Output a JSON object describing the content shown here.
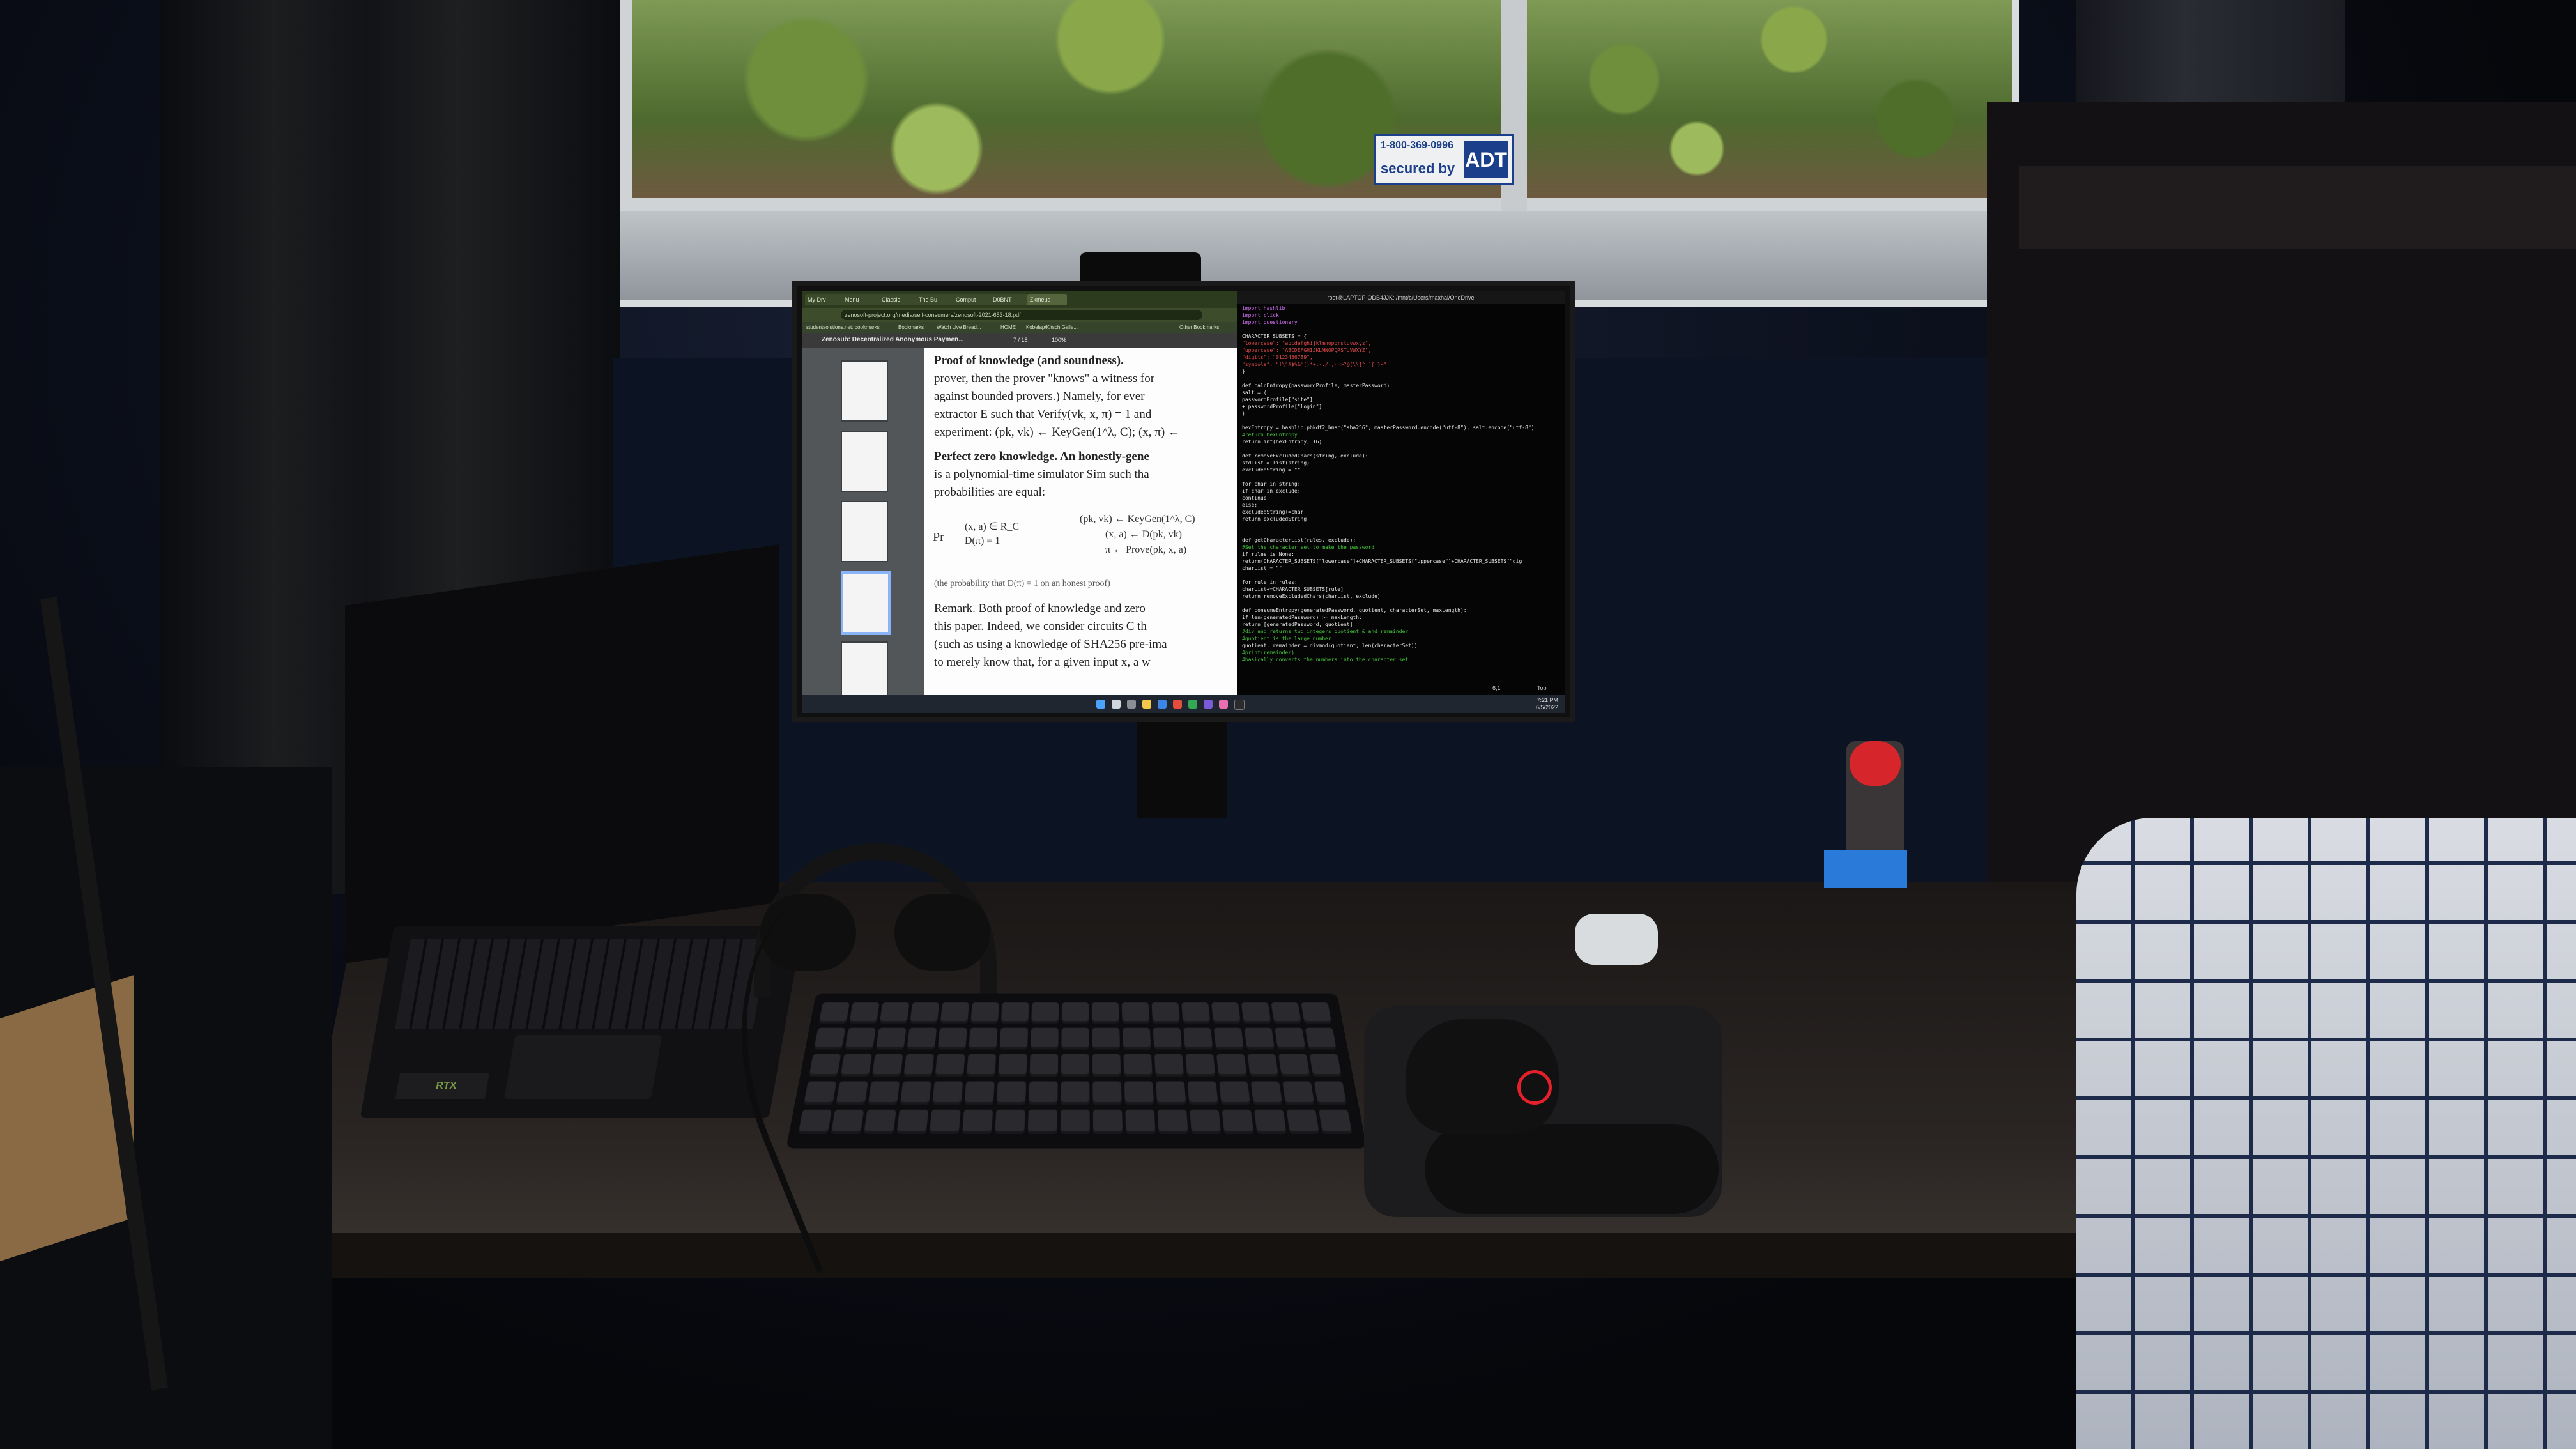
{
  "scene": {
    "window": {
      "sticker": {
        "phone": "1-800-369-0996",
        "label": "secured by",
        "brand": "ADT"
      }
    }
  },
  "monitor": {
    "browser": {
      "tabs": [
        "My Drv",
        "Menu",
        "Classic",
        "The Bu",
        "Comput",
        "D0BNT",
        "Zkmeus"
      ],
      "url": "zenosoft-project.org/media/self-consumers/zenosoft-2021-653-18.pdf",
      "bookmarks": [
        "studentsolutions.net: bookmarks",
        "Bookmarks",
        "Watch Live Bread...",
        "HOME",
        "Kobelap/Kitsch Galle...",
        "Other Bookmarks"
      ],
      "pdf": {
        "title": "Zenosub: Decentralized Anonymous Paymen...",
        "page_indicator": "7 / 18",
        "zoom": "100%",
        "lines": [
          "Proof of knowledge (and soundness).",
          "prover, then the prover \"knows\" a witness for",
          "against bounded provers.) Namely, for ever",
          "extractor E such that Verify(vk, x, π) = 1 and",
          "experiment: (pk, vk) ← KeyGen(1^λ, C); (x, π) ←",
          "Perfect zero knowledge.  An honestly-gene",
          "is a polynomial-time simulator Sim such tha",
          "probabilities are equal:",
          "(the probability that D(π) = 1 on an honest proof)",
          "Remark.  Both proof of knowledge and zero",
          "this paper. Indeed, we consider circuits C th",
          "(such as using a knowledge of SHA256 pre-ima",
          "to merely know that, for a given input x, a w"
        ],
        "formula": {
          "lhs_top": "(x, a) ∈ R_C",
          "lhs_bottom": "D(π) = 1",
          "rhs_1": "(pk, vk) ← KeyGen(1^λ, C)",
          "rhs_2": "(x, a) ← D(pk, vk)",
          "rhs_3": "π ← Prove(pk, x, a)",
          "prefix": "Pr"
        }
      }
    },
    "terminal": {
      "title": "root@LAPTOP-ODB4JJK: /mnt/c/Users/maxhal/OneDrive",
      "status_left": "6,1",
      "status_right": "Top",
      "code_lines": [
        {
          "text": "import hashlib",
          "color": "#d36ff3"
        },
        {
          "text": "import click",
          "color": "#d36ff3"
        },
        {
          "text": "import questionary",
          "color": "#d36ff3"
        },
        {
          "text": "",
          "color": "#cfcfcf"
        },
        {
          "text": "CHARACTER_SUBSETS = {",
          "color": "#e6e6e6"
        },
        {
          "text": "    \"lowercase\": \"abcdefghijklmnopqrstuvwxyz\",",
          "color": "#e04848"
        },
        {
          "text": "    \"uppercase\": \"ABCDEFGHIJKLMNOPQRSTUVWXYZ\",",
          "color": "#e04848"
        },
        {
          "text": "    \"digits\": \"0123456789\",",
          "color": "#e04848"
        },
        {
          "text": "    \"symbols\": \"!\\\"#$%&'()*+,-./:;<=>?@[\\\\]^_`{|}~\"",
          "color": "#e04848"
        },
        {
          "text": "}",
          "color": "#e6e6e6"
        },
        {
          "text": "",
          "color": "#cfcfcf"
        },
        {
          "text": "def calcEntropy(passwordProfile, masterPassword):",
          "color": "#e6e6e6"
        },
        {
          "text": "    salt = (",
          "color": "#e6e6e6"
        },
        {
          "text": "        passwordProfile[\"site\"]",
          "color": "#e6e6e6"
        },
        {
          "text": "        + passwordProfile[\"login\"]",
          "color": "#e6e6e6"
        },
        {
          "text": "    )",
          "color": "#e6e6e6"
        },
        {
          "text": "",
          "color": "#cfcfcf"
        },
        {
          "text": "    hexEntropy = hashlib.pbkdf2_hmac(\"sha256\", masterPassword.encode(\"utf-8\"), salt.encode(\"utf-8\")",
          "color": "#e6e6e6"
        },
        {
          "text": "    #return hexEntropy",
          "color": "#43c43a"
        },
        {
          "text": "    return int(hexEntropy, 16)",
          "color": "#e6e6e6"
        },
        {
          "text": "",
          "color": "#cfcfcf"
        },
        {
          "text": "def removeExcludedChars(string, exclude):",
          "color": "#e6e6e6"
        },
        {
          "text": "    stdList = list(string)",
          "color": "#e6e6e6"
        },
        {
          "text": "    excludedString = \"\"",
          "color": "#e6e6e6"
        },
        {
          "text": "",
          "color": "#cfcfcf"
        },
        {
          "text": "    for char in string:",
          "color": "#e6e6e6"
        },
        {
          "text": "        if char in exclude:",
          "color": "#e6e6e6"
        },
        {
          "text": "            continue",
          "color": "#e6e6e6"
        },
        {
          "text": "        else:",
          "color": "#e6e6e6"
        },
        {
          "text": "            excludedString+=char",
          "color": "#e6e6e6"
        },
        {
          "text": "    return excludedString",
          "color": "#e6e6e6"
        },
        {
          "text": "",
          "color": "#cfcfcf"
        },
        {
          "text": "",
          "color": "#cfcfcf"
        },
        {
          "text": "def getCharacterList(rules, exclude):",
          "color": "#e6e6e6"
        },
        {
          "text": "    #Set the character set to make the password",
          "color": "#43c43a"
        },
        {
          "text": "    if rules is None:",
          "color": "#e6e6e6"
        },
        {
          "text": "        return(CHARACTER_SUBSETS[\"lowercase\"]+CHARACTER_SUBSETS[\"uppercase\"]+CHARACTER_SUBSETS[\"dig",
          "color": "#e6e6e6"
        },
        {
          "text": "    charList = \"\"",
          "color": "#e6e6e6"
        },
        {
          "text": "",
          "color": "#cfcfcf"
        },
        {
          "text": "    for rule in rules:",
          "color": "#e6e6e6"
        },
        {
          "text": "        charList+=CHARACTER_SUBSETS[rule]",
          "color": "#e6e6e6"
        },
        {
          "text": "    return removeExcludedChars(charList, exclude)",
          "color": "#e6e6e6"
        },
        {
          "text": "",
          "color": "#cfcfcf"
        },
        {
          "text": "def consumeEntropy(generatedPassword, quotient, characterSet, maxLength):",
          "color": "#e6e6e6"
        },
        {
          "text": "    if len(generatedPassword) >= maxLength:",
          "color": "#e6e6e6"
        },
        {
          "text": "        return [generatedPassword, quotient]",
          "color": "#e6e6e6"
        },
        {
          "text": "    #div and returns two integers quotient & and remainder",
          "color": "#43c43a"
        },
        {
          "text": "    #quotient is the large number",
          "color": "#43c43a"
        },
        {
          "text": "    quotient, remainder = divmod(quotient, len(characterSet))",
          "color": "#e6e6e6"
        },
        {
          "text": "    #print(remainder)",
          "color": "#43c43a"
        },
        {
          "text": "    #basically converts the numbers into the character set",
          "color": "#43c43a"
        }
      ]
    },
    "taskbar": {
      "time": "7:21 PM",
      "date": "6/5/2022"
    }
  },
  "laptop": {
    "badge": "RTX"
  },
  "colors": {
    "accent_blue": "#2a7bd9",
    "mouse_logo_red": "#e4202a",
    "bottle_cap_red": "#d6262b"
  }
}
